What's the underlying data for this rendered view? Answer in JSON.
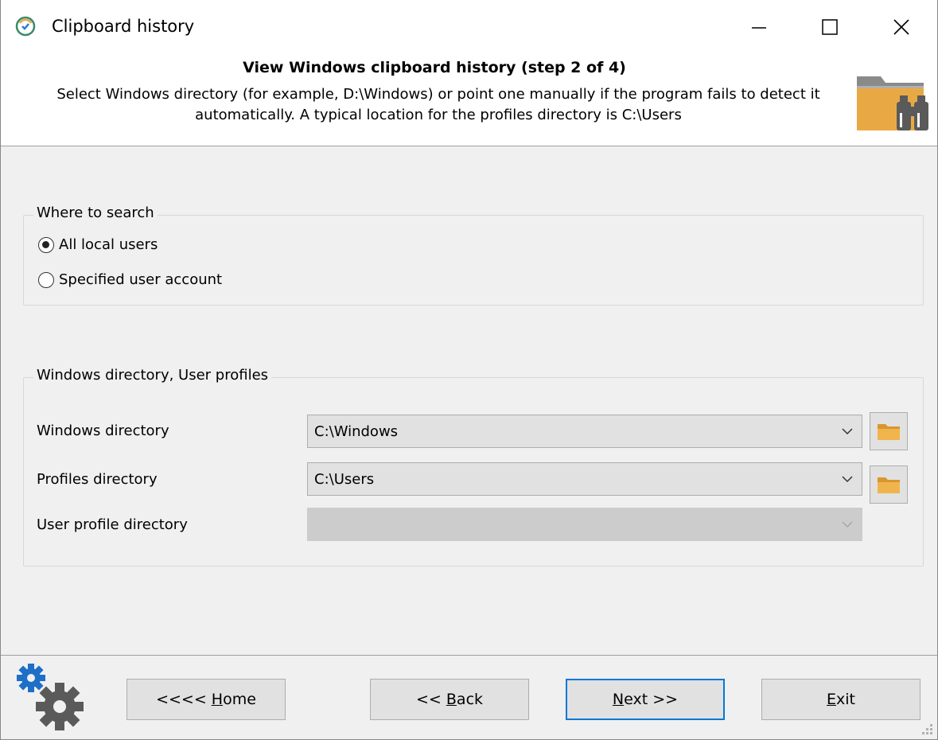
{
  "window": {
    "title": "Clipboard history",
    "app_icon": "clipboard-history-icon"
  },
  "header": {
    "title": "View Windows clipboard history (step 2 of 4)",
    "description_line1": "Select Windows directory (for example, D:\\Windows) or point one manually if the program fails to detect it",
    "description_line2": "automatically. A typical location for the profiles directory is C:\\Users",
    "icon": "folder-binoculars-icon"
  },
  "where_to_search": {
    "legend": "Where to search",
    "options": [
      {
        "label": "All local users",
        "selected": true
      },
      {
        "label": "Specified user account",
        "selected": false
      }
    ]
  },
  "directories": {
    "legend": "Windows directory, User profiles",
    "windows_dir": {
      "label": "Windows directory",
      "value": "C:\\Windows"
    },
    "profiles_dir": {
      "label": "Profiles directory",
      "value": "C:\\Users"
    },
    "user_profile_dir": {
      "label": "User profile directory",
      "value": "",
      "disabled": true
    }
  },
  "footer": {
    "home_prefix": "<<<< ",
    "home_key": "H",
    "home_rest": "ome",
    "back_prefix": "<< ",
    "back_key": "B",
    "back_rest": "ack",
    "next_key": "N",
    "next_rest": "ext >>",
    "exit_key": "E",
    "exit_rest": "xit"
  },
  "colors": {
    "folder": "#e8a945",
    "accent": "#0078d7",
    "gear": "#5a5a5a",
    "gear_small": "#1e6fc7"
  }
}
